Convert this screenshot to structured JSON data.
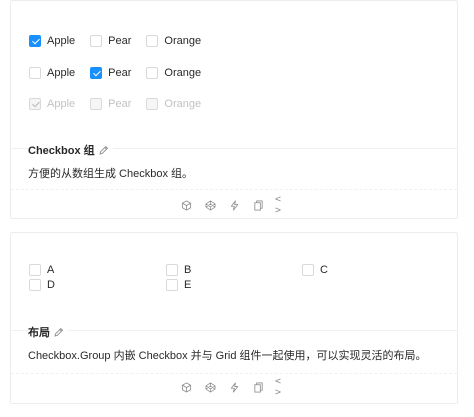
{
  "demo1": {
    "rows": [
      [
        {
          "label": "Apple",
          "checked": true,
          "disabled": false
        },
        {
          "label": "Pear",
          "checked": false,
          "disabled": false
        },
        {
          "label": "Orange",
          "checked": false,
          "disabled": false
        }
      ],
      [
        {
          "label": "Apple",
          "checked": false,
          "disabled": false
        },
        {
          "label": "Pear",
          "checked": true,
          "disabled": false
        },
        {
          "label": "Orange",
          "checked": false,
          "disabled": false
        }
      ],
      [
        {
          "label": "Apple",
          "checked": true,
          "disabled": true
        },
        {
          "label": "Pear",
          "checked": false,
          "disabled": true
        },
        {
          "label": "Orange",
          "checked": false,
          "disabled": true
        }
      ]
    ],
    "title": "Checkbox 组",
    "description": "方便的从数组生成 Checkbox 组。"
  },
  "demo2": {
    "items": [
      {
        "label": "A",
        "checked": false
      },
      {
        "label": "B",
        "checked": false
      },
      {
        "label": "C",
        "checked": false
      },
      {
        "label": "D",
        "checked": false
      },
      {
        "label": "E",
        "checked": false
      }
    ],
    "title": "布局",
    "description": "Checkbox.Group 内嵌 Checkbox 并与 Grid 组件一起使用，可以实现灵活的布局。"
  },
  "actions": [
    "codesandbox-icon",
    "codepen-icon",
    "riddle-icon",
    "copy-icon",
    "code-expand-icon"
  ],
  "code_glyph": "< >",
  "colors": {
    "accent": "#1890ff",
    "border": "#ececec",
    "disabled_text": "#bfbfbf"
  }
}
